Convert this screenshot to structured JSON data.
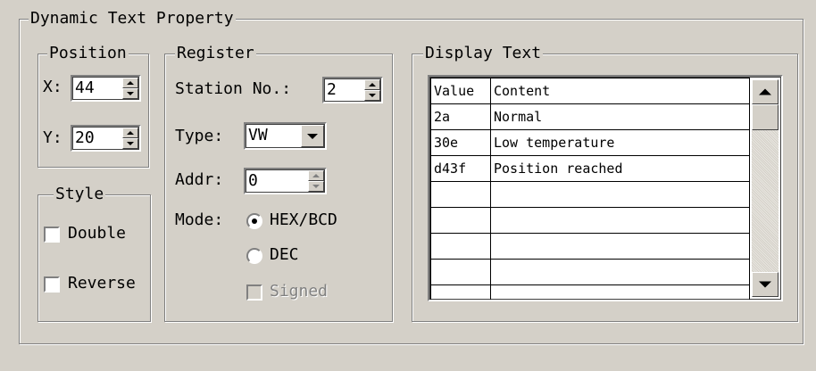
{
  "dialog": {
    "title": "Dynamic Text Property"
  },
  "position": {
    "legend": "Position",
    "x_label": "X:",
    "x_value": "44",
    "y_label": "Y:",
    "y_value": "20"
  },
  "style": {
    "legend": "Style",
    "double_label": "Double",
    "double_checked": false,
    "reverse_label": "Reverse",
    "reverse_checked": false
  },
  "register": {
    "legend": "Register",
    "station_label": "Station No.:",
    "station_value": "2",
    "type_label": "Type:",
    "type_value": "VW",
    "addr_label": "Addr:",
    "addr_value": "0",
    "mode_label": "Mode:",
    "mode_options": [
      "HEX/BCD",
      "DEC"
    ],
    "mode_selected": "HEX/BCD",
    "signed_label": "Signed",
    "signed_enabled": false
  },
  "display_text": {
    "legend": "Display Text",
    "columns": [
      "Value",
      "Content"
    ],
    "rows": [
      [
        "2a",
        "Normal"
      ],
      [
        "30e",
        "Low temperature"
      ],
      [
        "d43f",
        "Position reached"
      ],
      [
        "",
        ""
      ],
      [
        "",
        ""
      ],
      [
        "",
        ""
      ],
      [
        "",
        ""
      ],
      [
        "",
        ""
      ]
    ]
  },
  "icons": {
    "spin": "spinner-arrows-icon",
    "dropdown": "chevron-down-icon",
    "scroll_up": "scroll-up-icon",
    "scroll_down": "scroll-down-icon"
  }
}
